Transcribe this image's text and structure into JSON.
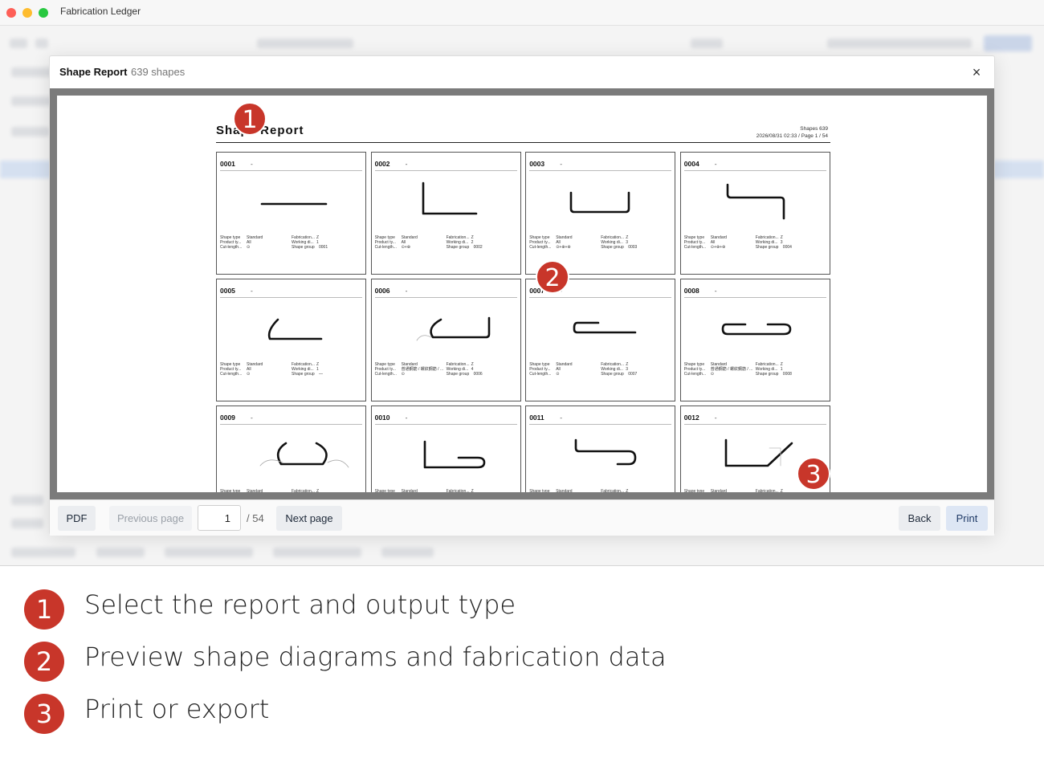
{
  "window": {
    "title": "Fabrication Ledger"
  },
  "dialog": {
    "title": "Shape Report",
    "count": "639 shapes",
    "close_glyph": "×"
  },
  "report": {
    "title": "Shape Report",
    "meta_line1": "Shapes 639",
    "meta_line2": "2026/08/31 02:33 / Page 1 / 54"
  },
  "labels": {
    "shape_type": "Shape type",
    "product_type": "Product ty...",
    "cut_length": "Cut-length...",
    "fabrication": "Fabrication...",
    "working_dim": "Working di...",
    "shape_group": "Shape group"
  },
  "cards": [
    {
      "id": "0001",
      "sub": "-",
      "shape": "line",
      "shape_type": "Standard",
      "product": "All",
      "cut": "⊙",
      "fab": "Z",
      "work": "1",
      "group": "0001"
    },
    {
      "id": "0002",
      "sub": "-",
      "shape": "L",
      "shape_type": "Standard",
      "product": "All",
      "cut": "⊙+⊕",
      "fab": "Z",
      "work": "2",
      "group": "0002"
    },
    {
      "id": "0003",
      "sub": "-",
      "shape": "U",
      "shape_type": "Standard",
      "product": "All",
      "cut": "⊙+⊕+⊛",
      "fab": "Z",
      "work": "3",
      "group": "0003"
    },
    {
      "id": "0004",
      "sub": "-",
      "shape": "Z",
      "shape_type": "Standard",
      "product": "All",
      "cut": "⊙+⊕+⊛",
      "fab": "Z",
      "work": "3",
      "group": "0004"
    },
    {
      "id": "0005",
      "sub": "-",
      "shape": "hookL",
      "shape_type": "Standard",
      "product": "All",
      "cut": "⊙",
      "fab": "Z",
      "work": "1",
      "group": "—"
    },
    {
      "id": "0006",
      "sub": "-",
      "shape": "hookU",
      "shape_type": "Standard",
      "product": "普通鋼筋 / 螺紋鋼筋 / ...",
      "cut": "⊙",
      "fab": "Z",
      "work": "4",
      "group": "0006"
    },
    {
      "id": "0007",
      "sub": "-",
      "shape": "hookFlat",
      "shape_type": "Standard",
      "product": "All",
      "cut": "⊙",
      "fab": "Z",
      "work": "3",
      "group": "0007"
    },
    {
      "id": "0008",
      "sub": "-",
      "shape": "doubleHook",
      "shape_type": "Standard",
      "product": "普通鋼筋 / 螺紋鋼筋 / ...",
      "cut": "⊙",
      "fab": "Z",
      "work": "1",
      "group": "0008"
    },
    {
      "id": "0009",
      "sub": "-",
      "shape": "hookBoth",
      "shape_type": "Standard",
      "product": "",
      "cut": "",
      "fab": "Z",
      "work": "",
      "group": ""
    },
    {
      "id": "0010",
      "sub": "-",
      "shape": "Jhook",
      "shape_type": "Standard",
      "product": "",
      "cut": "",
      "fab": "Z",
      "work": "",
      "group": ""
    },
    {
      "id": "0011",
      "sub": "-",
      "shape": "Shook",
      "shape_type": "Standard",
      "product": "",
      "cut": "",
      "fab": "Z",
      "work": "",
      "group": ""
    },
    {
      "id": "0012",
      "sub": "-",
      "shape": "angled",
      "shape_type": "Standard",
      "product": "",
      "cut": "",
      "fab": "Z",
      "work": "",
      "group": ""
    }
  ],
  "footer": {
    "pdf": "PDF",
    "previous": "Previous page",
    "page_current": "1",
    "page_total": "/ 54",
    "next": "Next page",
    "back": "Back",
    "print": "Print"
  },
  "markers": [
    "1",
    "2",
    "3"
  ],
  "legend": [
    {
      "num": "1",
      "text": "Select the report and output type"
    },
    {
      "num": "2",
      "text": "Preview shape diagrams and fabrication data"
    },
    {
      "num": "3",
      "text": "Print or export"
    }
  ],
  "colors": {
    "marker": "#c8362a",
    "preview_frame": "#7b7b7b"
  }
}
